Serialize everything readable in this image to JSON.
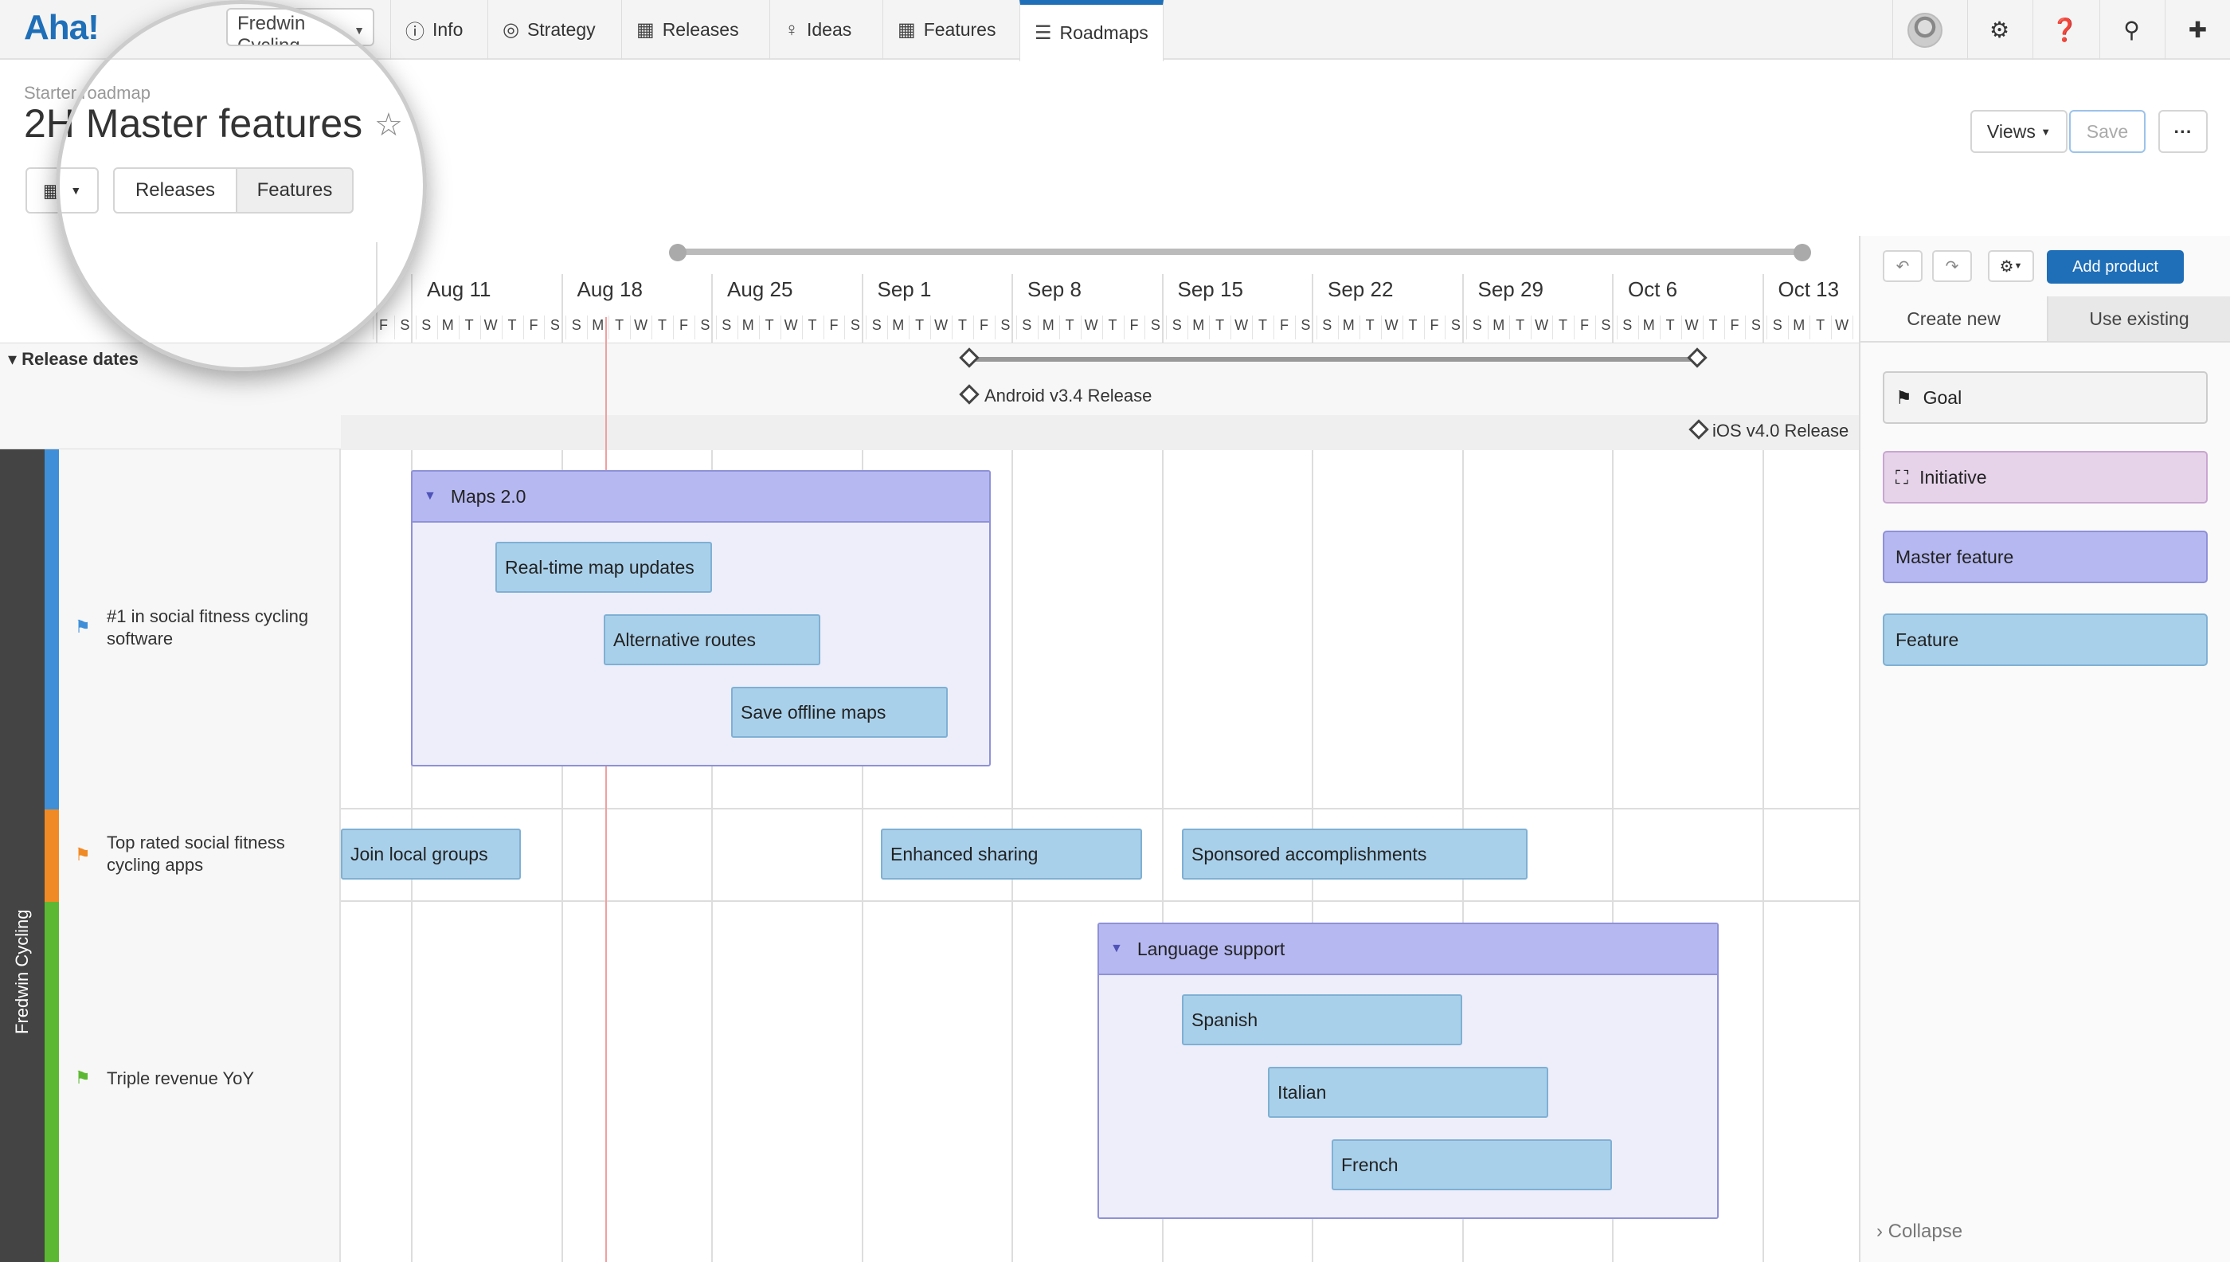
{
  "app": {
    "logo": "Aha!",
    "product": "Fredwin Cycling"
  },
  "nav": {
    "tabs": [
      {
        "label": "Info",
        "icon": "info-icon"
      },
      {
        "label": "Strategy",
        "icon": "target-icon"
      },
      {
        "label": "Releases",
        "icon": "calendar-icon"
      },
      {
        "label": "Ideas",
        "icon": "lightbulb-icon"
      },
      {
        "label": "Features",
        "icon": "grid-icon"
      },
      {
        "label": "Roadmaps",
        "icon": "roadmap-icon"
      }
    ]
  },
  "header": {
    "breadcrumb": "Starter roadmap",
    "title": "2H Master features",
    "views_label": "Views",
    "save_label": "Save",
    "more_label": "···",
    "segment": [
      "Releases",
      "Features"
    ]
  },
  "timeline": {
    "weeks": [
      "Aug 11",
      "Aug 18",
      "Aug 25",
      "Sep 1",
      "Sep 8",
      "Sep 15",
      "Sep 22",
      "Sep 29",
      "Oct 6",
      "Oct 13"
    ],
    "days": [
      "F",
      "S",
      "S",
      "M",
      "T",
      "W",
      "T",
      "F",
      "S",
      "S",
      "M",
      "T",
      "W",
      "T",
      "F",
      "S",
      "S",
      "M",
      "T",
      "W",
      "T",
      "F",
      "S",
      "S",
      "M",
      "T",
      "W",
      "T",
      "F",
      "S",
      "S",
      "M",
      "T",
      "W",
      "T",
      "F",
      "S",
      "S",
      "M",
      "T",
      "W",
      "T",
      "F",
      "S",
      "S",
      "M",
      "T",
      "W",
      "T",
      "F",
      "S",
      "S",
      "M",
      "T",
      "W",
      "T",
      "F",
      "S",
      "S",
      "M",
      "T",
      "W",
      "T",
      "F",
      "S",
      "S",
      "M",
      "T",
      "W",
      "T"
    ],
    "release_section": "Release dates",
    "releases": [
      "Android v3.4 Release",
      "iOS v4.0 Release"
    ],
    "product": "Fredwin Cycling",
    "goals": [
      {
        "label": "#1 in social fitness cycling software",
        "color": "#3f8fd8"
      },
      {
        "label": "Top rated social fitness cycling apps",
        "color": "#f08a24"
      },
      {
        "label": "Triple revenue YoY",
        "color": "#5cb833"
      }
    ],
    "master_features": [
      "Maps 2.0",
      "Language support"
    ],
    "features": {
      "maps": [
        "Real-time map updates",
        "Alternative routes",
        "Save offline maps"
      ],
      "row2": [
        "Join local groups",
        "Enhanced sharing",
        "Sponsored accomplishments"
      ],
      "language": [
        "Spanish",
        "Italian",
        "French"
      ]
    }
  },
  "right_panel": {
    "add_product": "Add product",
    "tabs": [
      "Create new",
      "Use existing"
    ],
    "cards": [
      "Goal",
      "Initiative",
      "Master feature",
      "Feature"
    ],
    "collapse": "Collapse"
  },
  "colors": {
    "brand": "#1f6fb8",
    "feature": "#a9d0ea",
    "master_feature": "#b6b8f1",
    "initiative": "#e6d3ea",
    "goal": "#f3f3f3"
  }
}
